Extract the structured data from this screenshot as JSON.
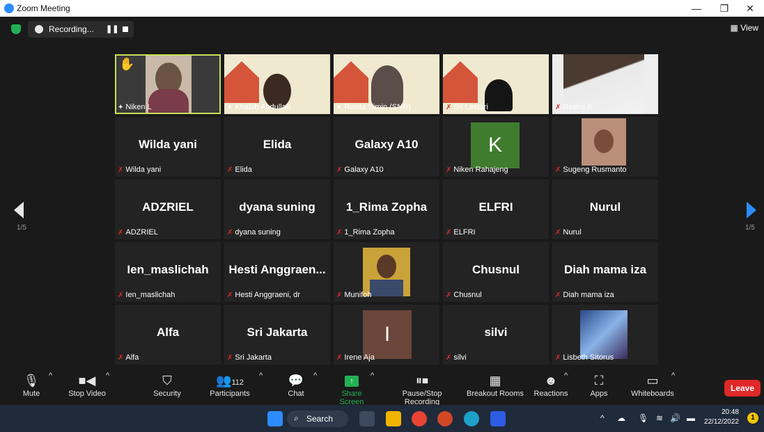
{
  "window": {
    "title": "Zoom Meeting"
  },
  "recording": {
    "label": "Recording...",
    "pause_icon": "pause-icon",
    "stop_icon": "stop-icon"
  },
  "view": {
    "label": "View"
  },
  "pager": {
    "left": "1/5",
    "right": "1/5"
  },
  "tiles_row1": [
    {
      "label": "Niken L"
    },
    {
      "label": "Khabib Abdullah"
    },
    {
      "label": "Rosita Simin (SNR)"
    },
    {
      "label": "Sri Lestari"
    },
    {
      "label": "Redmi 8"
    }
  ],
  "tiles": [
    {
      "name": "Wilda yani",
      "label": "Wilda yani"
    },
    {
      "name": "Elida",
      "label": "Elida"
    },
    {
      "name": "Galaxy A10",
      "label": "Galaxy A10"
    },
    {
      "name": "K",
      "label": "Niken Rahajeng"
    },
    {
      "name": "",
      "label": "Sugeng Rusmanto"
    },
    {
      "name": "ADZRIEL",
      "label": "ADZRIEL"
    },
    {
      "name": "dyana suning",
      "label": "dyana suning"
    },
    {
      "name": "1_Rima Zopha",
      "label": "1_Rima Zopha"
    },
    {
      "name": "ELFRI",
      "label": "ELFRI"
    },
    {
      "name": "Nurul",
      "label": "Nurul"
    },
    {
      "name": "Ien_maslichah",
      "label": "Ien_maslichah"
    },
    {
      "name": "Hesti Anggraen...",
      "label": "Hesti Anggraeni, dr"
    },
    {
      "name": "",
      "label": "Munifoh"
    },
    {
      "name": "Chusnul",
      "label": "Chusnul"
    },
    {
      "name": "Diah mama iza",
      "label": "Diah mama iza"
    },
    {
      "name": "Alfa",
      "label": "Alfa"
    },
    {
      "name": "Sri Jakarta",
      "label": "Sri Jakarta"
    },
    {
      "name": "I",
      "label": "Irene Aja"
    },
    {
      "name": "silvi",
      "label": "silvi"
    },
    {
      "name": "",
      "label": "Lisbeth Sitorus"
    }
  ],
  "toolbar": {
    "mute": "Mute",
    "stop_video": "Stop Video",
    "security": "Security",
    "participants": "Participants",
    "participants_count": "112",
    "chat": "Chat",
    "share_screen": "Share Screen",
    "pause_stop_recording": "Pause/Stop Recording",
    "breakout_rooms": "Breakout Rooms",
    "reactions": "Reactions",
    "apps": "Apps",
    "whiteboards": "Whiteboards",
    "leave": "Leave"
  },
  "taskbar": {
    "search": "Search",
    "time": "20:48",
    "date": "22/12/2022",
    "notifications": "1"
  },
  "colors": {
    "accent": "#2d8cff",
    "leave": "#e02828",
    "share": "#23b055",
    "active_speaker": "#c8e05a",
    "initial_tile": "#3f7c2e"
  }
}
